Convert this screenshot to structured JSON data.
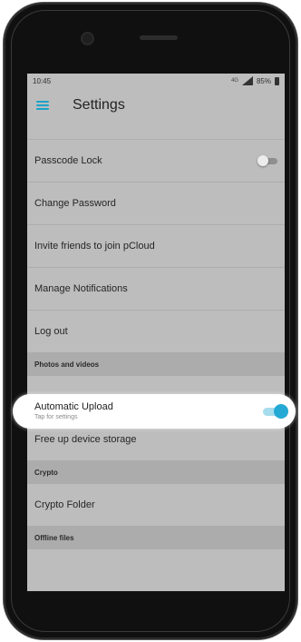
{
  "status_bar": {
    "time": "10:45",
    "network": "4G",
    "battery": "85%"
  },
  "app_bar": {
    "title": "Settings"
  },
  "rows": {
    "passcode_lock": "Passcode Lock",
    "change_password": "Change Password",
    "invite_friends": "Invite friends to join pCloud",
    "manage_notifications": "Manage Notifications",
    "log_out": "Log out",
    "free_up_storage": "Free up device storage",
    "crypto_folder": "Crypto Folder"
  },
  "sections": {
    "photos_videos": "Photos and videos",
    "crypto": "Crypto",
    "offline_files": "Offline files"
  },
  "automatic_upload": {
    "title": "Automatic Upload",
    "subtitle": "Tap for settings",
    "enabled": true
  },
  "passcode_lock_enabled": false,
  "colors": {
    "accent": "#24a9d4",
    "overlay": "#bdbdbd",
    "section_header": "#acacac"
  }
}
